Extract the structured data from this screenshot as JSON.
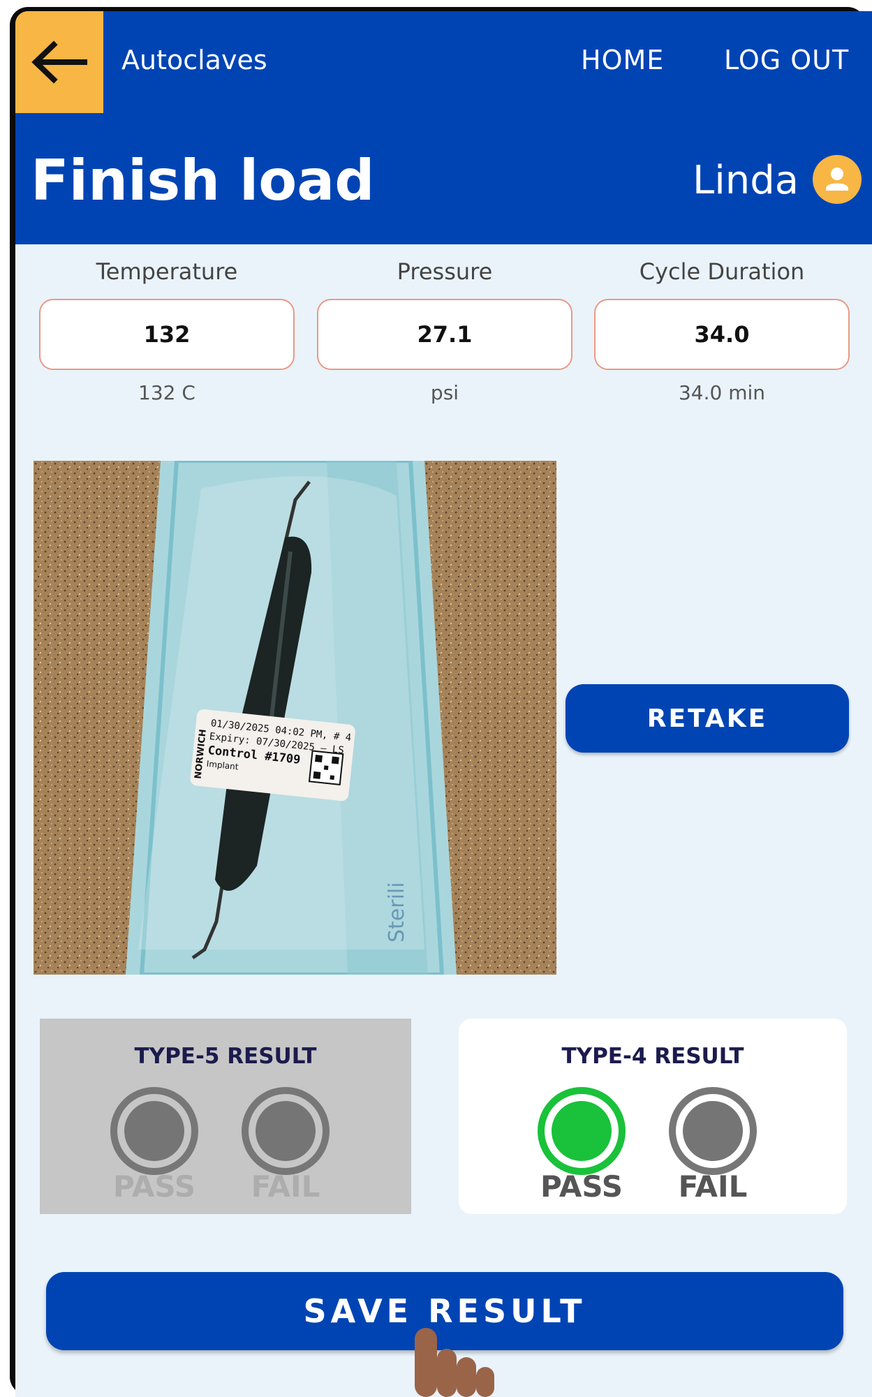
{
  "header": {
    "breadcrumb": "Autoclaves",
    "nav": {
      "home": "HOME",
      "logout": "LOG OUT"
    },
    "title": "Finish load",
    "user": "Linda"
  },
  "fields": [
    {
      "label": "Temperature",
      "value": "132",
      "unit": "132 C"
    },
    {
      "label": "Pressure",
      "value": "27.1",
      "unit": "psi"
    },
    {
      "label": "Cycle Duration",
      "value": "34.0",
      "unit": "34.0 min"
    }
  ],
  "photo": {
    "label_lines": [
      "01/30/2025 04:02 PM, # 4",
      "Expiry: 07/30/2025 – LS",
      "Control #1709",
      "Implant"
    ],
    "label_side": "NORWICH",
    "pouch_text": "Sterili"
  },
  "retake_label": "RETAKE",
  "results": {
    "type5": {
      "title": "TYPE-5 RESULT",
      "pass": "PASS",
      "fail": "FAIL",
      "selected": "none",
      "enabled": false
    },
    "type4": {
      "title": "TYPE-4 RESULT",
      "pass": "PASS",
      "fail": "FAIL",
      "selected": "pass",
      "enabled": true
    }
  },
  "save_label": "SAVE RESULT",
  "colors": {
    "primary": "#0044b4",
    "accent": "#f8b645",
    "pass_green": "#19c23a",
    "background": "#eaf3fa"
  }
}
